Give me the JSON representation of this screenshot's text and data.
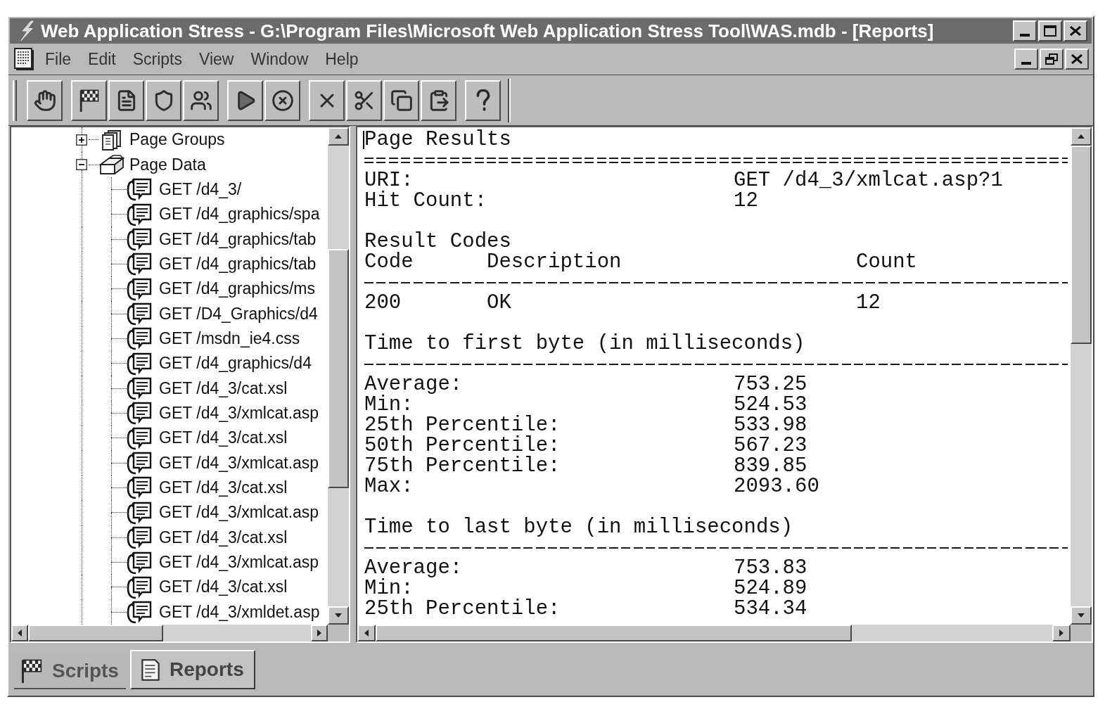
{
  "window": {
    "title": "Web Application Stress - G:\\Program Files\\Microsoft Web Application Stress Tool\\WAS.mdb - [Reports]"
  },
  "menu": [
    "File",
    "Edit",
    "Scripts",
    "View",
    "Window",
    "Help"
  ],
  "tree": {
    "items": [
      {
        "label": "Page Groups",
        "kind": "groups",
        "expanded": false
      },
      {
        "label": "Page Data",
        "kind": "pages",
        "expanded": true,
        "children": [
          {
            "label": "GET /d4_3/"
          },
          {
            "label": "GET /d4_graphics/spa"
          },
          {
            "label": "GET /d4_graphics/tab"
          },
          {
            "label": "GET /d4_graphics/tab"
          },
          {
            "label": "GET /d4_graphics/ms"
          },
          {
            "label": "GET /D4_Graphics/d4"
          },
          {
            "label": "GET /msdn_ie4.css"
          },
          {
            "label": "GET /d4_graphics/d4"
          },
          {
            "label": "GET /d4_3/cat.xsl"
          },
          {
            "label": "GET /d4_3/xmlcat.asp"
          },
          {
            "label": "GET /d4_3/cat.xsl"
          },
          {
            "label": "GET /d4_3/xmlcat.asp"
          },
          {
            "label": "GET /d4_3/cat.xsl"
          },
          {
            "label": "GET /d4_3/xmlcat.asp"
          },
          {
            "label": "GET /d4_3/cat.xsl"
          },
          {
            "label": "GET /d4_3/xmlcat.asp"
          },
          {
            "label": "GET /d4_3/cat.xsl"
          },
          {
            "label": "GET /d4_3/xmldet.asp"
          }
        ]
      }
    ]
  },
  "report": {
    "title": "Page Results",
    "summary": [
      {
        "label": "URI:",
        "value": "GET /d4_3/xmlcat.asp?1"
      },
      {
        "label": "Hit Count:",
        "value": "12"
      }
    ],
    "result_codes": {
      "title": "Result Codes",
      "columns": [
        "Code",
        "Description",
        "Count"
      ],
      "rows": [
        [
          "200",
          "OK",
          "12"
        ]
      ]
    },
    "timings": [
      {
        "title": "Time to first byte (in milliseconds)",
        "rows": [
          {
            "label": "Average:",
            "value": "753.25"
          },
          {
            "label": "Min:",
            "value": "524.53"
          },
          {
            "label": "25th Percentile:",
            "value": "533.98"
          },
          {
            "label": "50th Percentile:",
            "value": "567.23"
          },
          {
            "label": "75th Percentile:",
            "value": "839.85"
          },
          {
            "label": "Max:",
            "value": "2093.60"
          }
        ]
      },
      {
        "title": "Time to last byte (in milliseconds)",
        "rows": [
          {
            "label": "Average:",
            "value": "753.83"
          },
          {
            "label": "Min:",
            "value": "524.89"
          },
          {
            "label": "25th Percentile:",
            "value": "534.34"
          }
        ]
      }
    ]
  },
  "tabs": [
    {
      "label": "Scripts",
      "kind": "scripts",
      "selected": false
    },
    {
      "label": "Reports",
      "kind": "reports",
      "selected": true
    }
  ]
}
